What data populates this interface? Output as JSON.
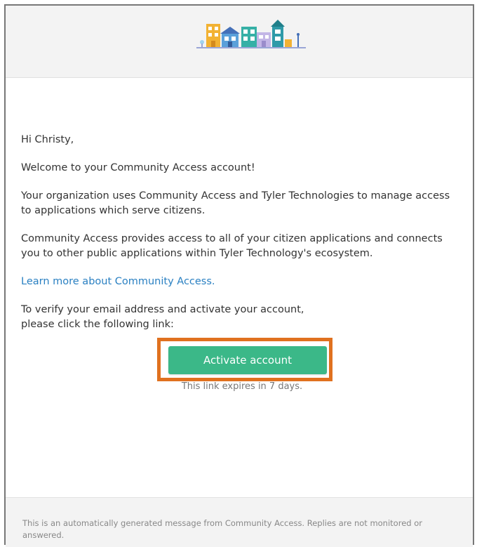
{
  "email": {
    "greeting": "Hi Christy,",
    "welcome": "Welcome to your Community Access account!",
    "paragraph_org": "Your organization uses Community Access and Tyler Technologies to manage access to applications which serve citizens.",
    "paragraph_provides": "Community Access provides access to all of your citizen applications and connects you to other public applications within Tyler Technology's ecosystem.",
    "learn_more_link": "Learn more about Community Access.",
    "verify_instructions_line1": "To verify your email address and activate your account,",
    "verify_instructions_line2": "please click the following link:",
    "activate_button_label": "Activate account",
    "link_expiry": "This link expires in 7 days.",
    "footer_notice": "This is an automatically generated message from Community Access. Replies are not monitored or answered."
  },
  "colors": {
    "button_green": "#3bb888",
    "highlight_orange": "#e0711f",
    "link_blue": "#2a80c2",
    "header_bg": "#f3f3f3"
  },
  "icons": {
    "logo": "community-access-buildings-logo"
  }
}
